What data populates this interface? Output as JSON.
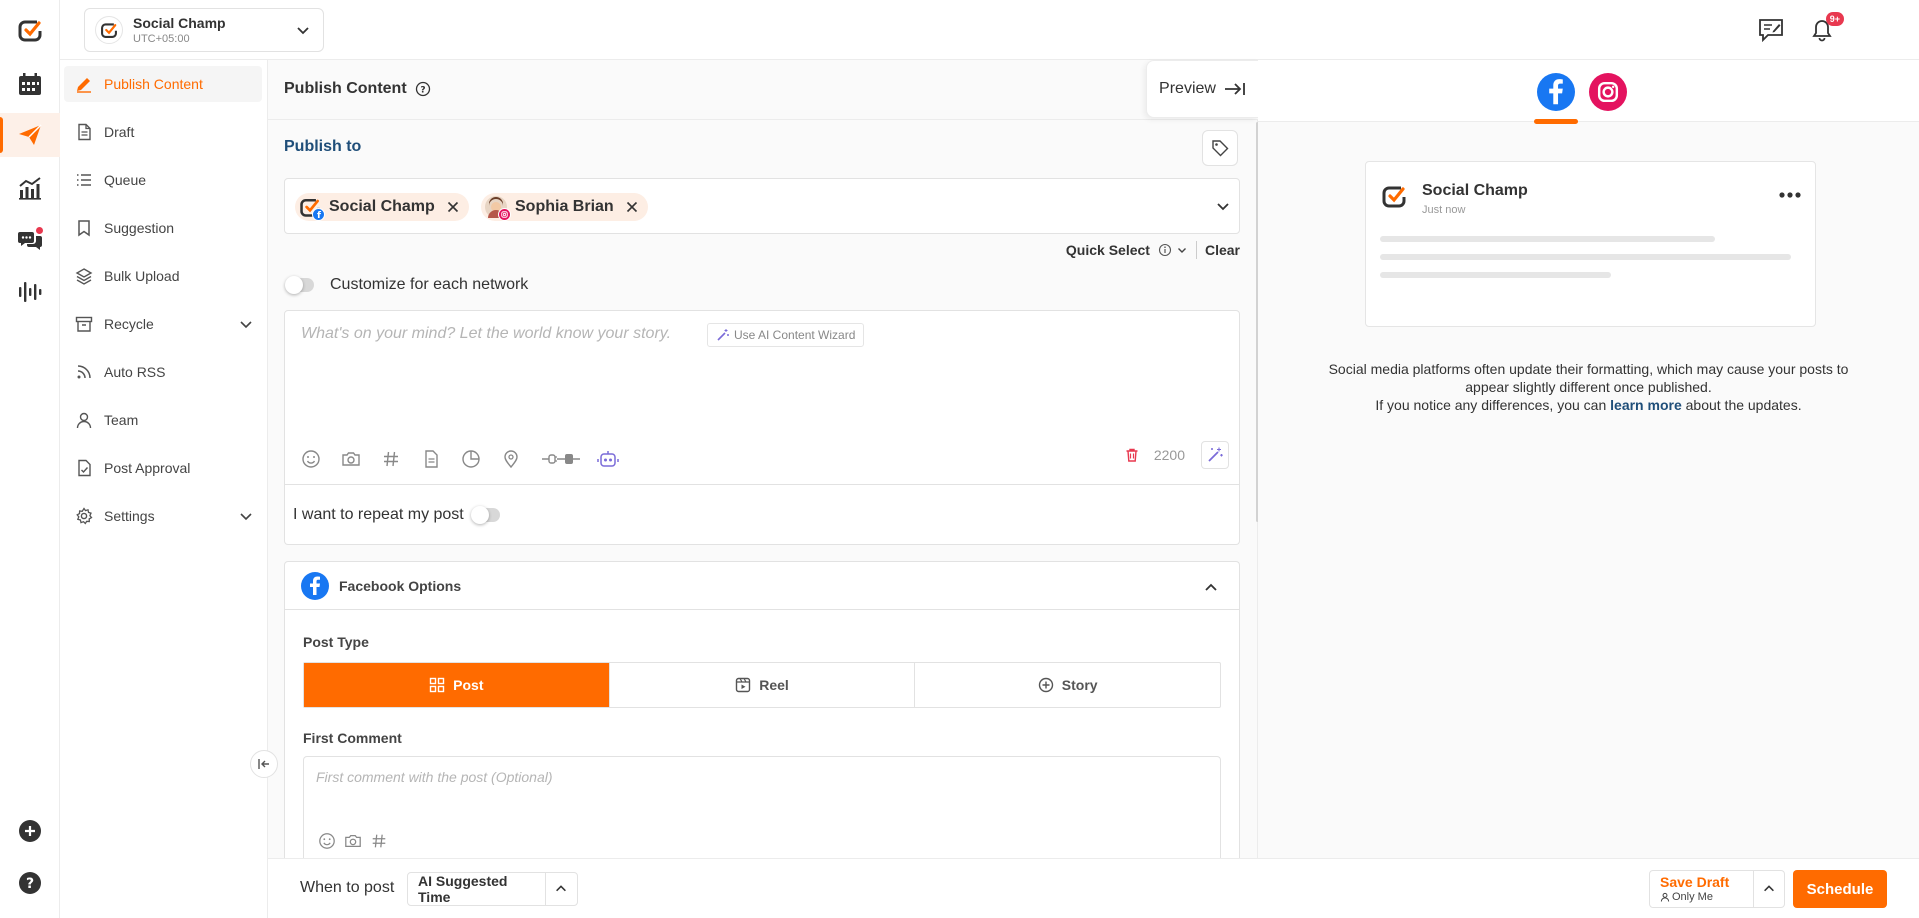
{
  "topbar": {
    "account_name": "Social Champ",
    "timezone": "UTC+05:00",
    "notifications_badge": "9+"
  },
  "sidebar": {
    "items": [
      {
        "label": "Publish Content",
        "icon": "pencil-icon",
        "active": true
      },
      {
        "label": "Draft",
        "icon": "document-icon"
      },
      {
        "label": "Queue",
        "icon": "list-icon"
      },
      {
        "label": "Suggestion",
        "icon": "bookmark-icon"
      },
      {
        "label": "Bulk Upload",
        "icon": "layers-icon"
      },
      {
        "label": "Recycle",
        "icon": "archive-icon",
        "expandable": true
      },
      {
        "label": "Auto RSS",
        "icon": "rss-icon"
      },
      {
        "label": "Team",
        "icon": "user-icon"
      },
      {
        "label": "Post Approval",
        "icon": "approval-doc-icon"
      },
      {
        "label": "Settings",
        "icon": "gear-icon",
        "expandable": true
      }
    ]
  },
  "main": {
    "title": "Publish Content",
    "preview_label": "Preview",
    "publish_to_label": "Publish to",
    "profiles": [
      {
        "name": "Social Champ",
        "network": "facebook"
      },
      {
        "name": "Sophia Brian",
        "network": "instagram"
      }
    ],
    "quick_select_label": "Quick Select",
    "clear_label": "Clear",
    "customize_label": "Customize for each network",
    "editor_placeholder": "What's on your mind? Let the world know your story.",
    "ai_wizard_label": "Use AI Content Wizard",
    "char_count": "2200",
    "repeat_label": "I want to repeat my post",
    "facebook_options": {
      "title": "Facebook Options",
      "post_type_label": "Post Type",
      "post_types": [
        "Post",
        "Reel",
        "Story"
      ],
      "selected_post_type": "Post",
      "first_comment_label": "First Comment",
      "first_comment_placeholder": "First comment with the post (Optional)"
    }
  },
  "bottom": {
    "when_label": "When to post",
    "time_option": "AI Suggested Time",
    "save_draft_label": "Save Draft",
    "save_draft_visibility": "Only Me",
    "schedule_label": "Schedule"
  },
  "preview": {
    "account_name": "Social Champ",
    "time": "Just now",
    "note_line1": "Social media platforms often update their formatting, which may cause your posts to appear slightly different once published.",
    "note_line2_pre": "If you notice any differences, you can",
    "note_link": "learn more",
    "note_line2_post": "about the updates."
  },
  "colors": {
    "accent": "#ff6b00",
    "facebook": "#1877f2",
    "instagram": "#e4135f",
    "heading_blue": "#1f4e79"
  }
}
